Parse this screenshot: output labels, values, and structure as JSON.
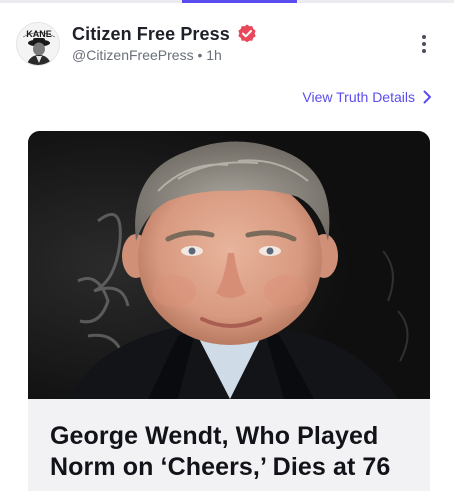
{
  "post": {
    "display_name": "Citizen Free Press",
    "handle": "@CitizenFreePress",
    "separator": "•",
    "time_ago": "1h",
    "avatar_text": "KANE",
    "verified_icon": "verified-badge-icon",
    "menu_icon": "more-vertical-icon"
  },
  "details_link": {
    "label": "View Truth Details",
    "icon": "chevron-right-icon"
  },
  "link_card": {
    "headline_line1": "George Wendt, Who Played",
    "headline_line2": "Norm on ‘Cheers,’ Dies at 76",
    "image_label": "photo"
  },
  "colors": {
    "accent": "#5b4cf0",
    "verified": "#e8485a",
    "text_primary": "#1f2128",
    "text_secondary": "#6a6f7a",
    "caption_bg": "#f2f2f4"
  }
}
